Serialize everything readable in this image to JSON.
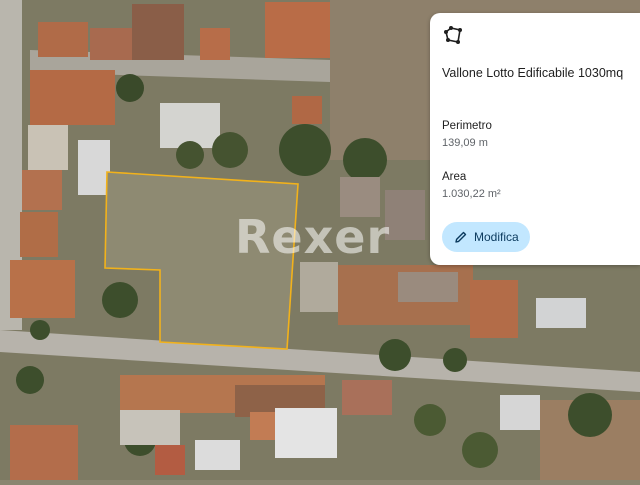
{
  "map": {
    "type": "satellite",
    "watermark": "Rexer",
    "parcel_outline_color": "#f2b21b"
  },
  "panel": {
    "icon": "polygon-icon",
    "title": "Vallone Lotto Edificabile 1030mq",
    "perimeter_label": "Perimetro",
    "perimeter_value": "139,09 m",
    "area_label": "Area",
    "area_value": "1.030,22 m²",
    "edit_button_label": "Modifica",
    "edit_icon": "pencil-icon",
    "button_color": "#c2e7ff"
  }
}
